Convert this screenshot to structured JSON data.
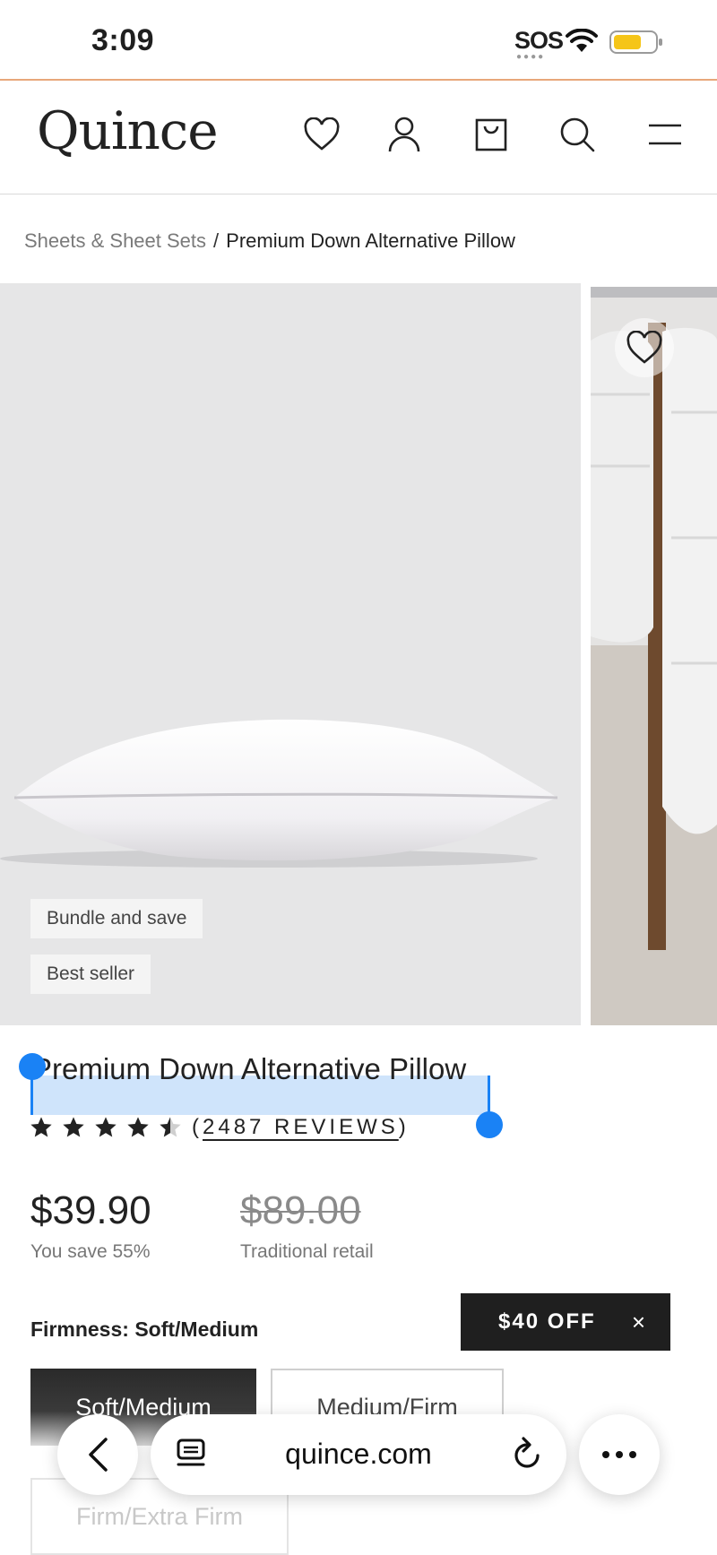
{
  "status_bar": {
    "time": "3:09",
    "sos": "SOS"
  },
  "header": {
    "logo": "Quince",
    "icons": [
      "heart-icon",
      "account-icon",
      "bag-icon",
      "search-icon",
      "menu-icon"
    ]
  },
  "breadcrumb": {
    "parent": "Sheets & Sheet Sets",
    "separator": "/",
    "current": "Premium Down Alternative Pillow"
  },
  "gallery": {
    "badges": [
      "Bundle and save",
      "Best seller"
    ]
  },
  "product": {
    "title": "Premium Down Alternative Pillow",
    "rating": 4.5,
    "reviews_open": "(",
    "reviews_text": "2487 REVIEWS",
    "reviews_close": ")",
    "price": "$39.90",
    "save_note": "You save 55%",
    "retail_price": "$89.00",
    "retail_note": "Traditional retail"
  },
  "firmness": {
    "label": "Firmness: Soft/Medium",
    "options": [
      "Soft/Medium",
      "Medium/Firm",
      "Firm/Extra Firm"
    ],
    "selected": "Soft/Medium"
  },
  "promo": {
    "text": "$40 OFF",
    "close": "×"
  },
  "browser": {
    "url": "quince.com"
  },
  "colors": {
    "selection": "#1a82f5",
    "selection_fill": "#cfe4fb",
    "accent_dark": "#1f1f1f"
  }
}
